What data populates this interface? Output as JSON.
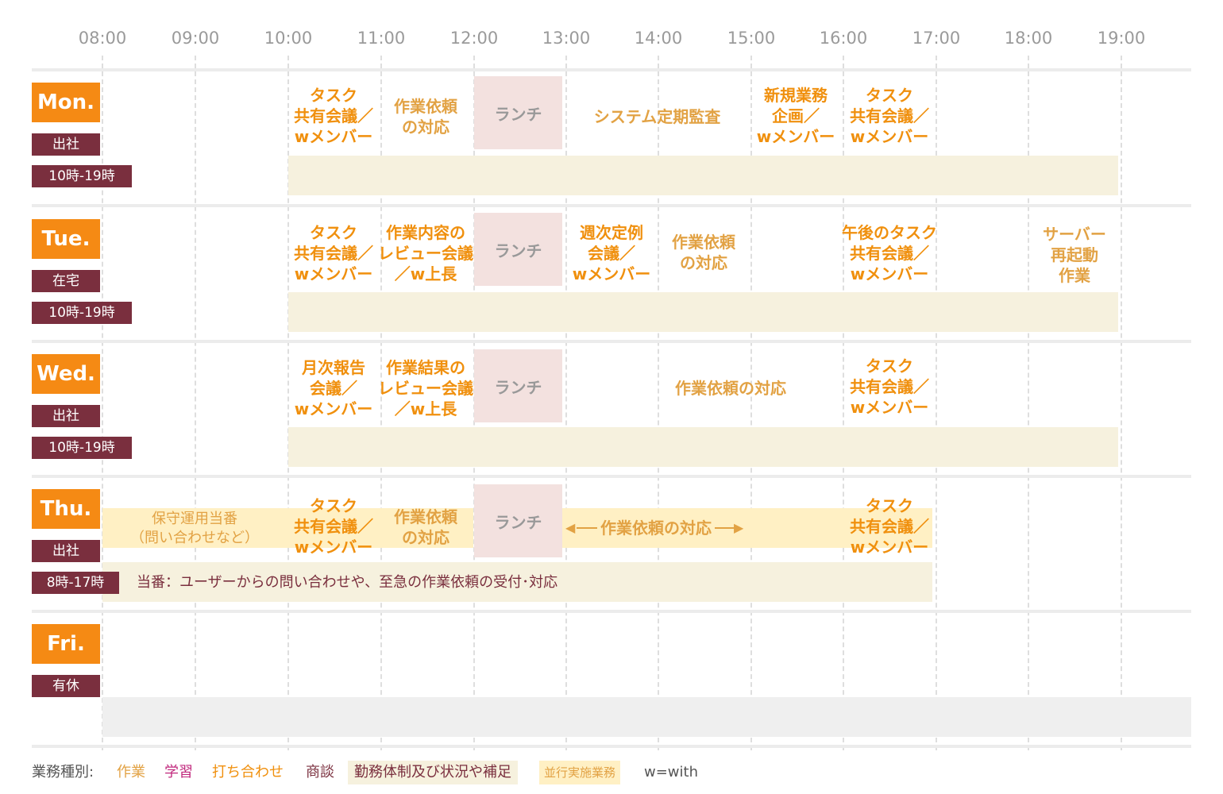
{
  "hours": [
    "08:00",
    "09:00",
    "10:00",
    "11:00",
    "12:00",
    "13:00",
    "14:00",
    "15:00",
    "16:00",
    "17:00",
    "18:00",
    "19:00"
  ],
  "lunch_label": "ランチ",
  "days": [
    {
      "day": "Mon.",
      "status": "出社",
      "hours": "10時-19時",
      "events": [
        {
          "text": "タスク\n共有会議／\nwメンバー"
        },
        {
          "text": "作業依頼\nの対応"
        },
        {
          "text": "システム定期監査"
        },
        {
          "text": "新規業務\n企画／\nwメンバー"
        },
        {
          "text": "タスク\n共有会議／\nwメンバー"
        }
      ]
    },
    {
      "day": "Tue.",
      "status": "在宅",
      "hours": "10時-19時",
      "events": [
        {
          "text": "タスク\n共有会議／\nwメンバー"
        },
        {
          "text": "作業内容の\nレビュー会議\n／w上長"
        },
        {
          "text": "週次定例\n会議／\nwメンバー"
        },
        {
          "text": "作業依頼\nの対応"
        },
        {
          "text": "午後のタスク\n共有会議／\nwメンバー"
        },
        {
          "text": "サーバー\n再起動\n作業"
        }
      ]
    },
    {
      "day": "Wed.",
      "status": "出社",
      "hours": "10時-19時",
      "events": [
        {
          "text": "月次報告\n会議／\nwメンバー"
        },
        {
          "text": "作業結果の\nレビュー会議\n／w上長"
        },
        {
          "text": "作業依頼の対応"
        },
        {
          "text": "タスク\n共有会議／\nwメンバー"
        }
      ]
    },
    {
      "day": "Thu.",
      "status": "出社",
      "hours": "8時-17時",
      "duty_text": "保守運用当番\n（問い合わせなど）",
      "note": "当番：ユーザーからの問い合わせや、至急の作業依頼の受付･対応",
      "arrow_text": "作業依頼の対応",
      "events": [
        {
          "text": "タスク\n共有会議／\nwメンバー"
        },
        {
          "text": "作業依頼\nの対応"
        },
        {
          "text": "タスク\n共有会議／\nwメンバー"
        }
      ]
    },
    {
      "day": "Fri.",
      "status": "有休"
    }
  ],
  "legend": {
    "title": "業務種別:",
    "items": [
      "作業",
      "学習",
      "打ち合わせ",
      "商談",
      "勤務体制及び状況や補足",
      "並行実施業務",
      "w=with"
    ],
    "colors": {
      "work": "#e2a244",
      "study": "#c0277c",
      "meeting": "#f0900e",
      "sales": "#7a2f3e",
      "note_bg": "#f6f1de",
      "parallel_bg": "#fff0c4"
    }
  }
}
